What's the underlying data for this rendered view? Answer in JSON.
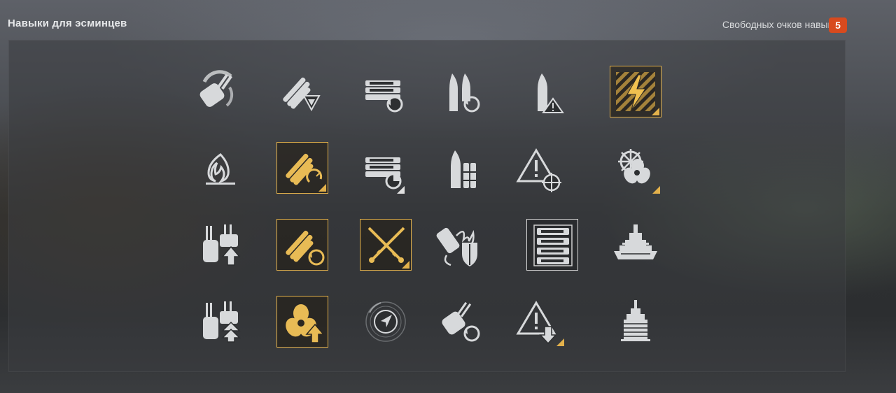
{
  "header": {
    "title": "Навыки для эсминцев",
    "free_points_label": "Свободных очков навыков:",
    "free_points_value": "5"
  },
  "colors": {
    "accent": "#e3b14b",
    "badge": "#d84a1e",
    "icon": "#d7d9db"
  },
  "skills": [
    {
      "name": "turret-rotation-icon",
      "selected": false
    },
    {
      "name": "torpedo-armament-icon",
      "selected": false
    },
    {
      "name": "consumable-reload-icon",
      "selected": false
    },
    {
      "name": "shell-reload-icon",
      "selected": false
    },
    {
      "name": "shell-warning-icon",
      "selected": false
    },
    {
      "name": "lightning-icon",
      "selected": true
    },
    {
      "name": "fire-icon",
      "selected": false
    },
    {
      "name": "torpedo-reload-icon",
      "selected": true
    },
    {
      "name": "consumable-timer-icon",
      "selected": false
    },
    {
      "name": "shell-ammo-icon",
      "selected": false
    },
    {
      "name": "warning-target-icon",
      "selected": false
    },
    {
      "name": "helm-propeller-icon",
      "selected": false
    },
    {
      "name": "turret-upgrade-icon",
      "selected": false
    },
    {
      "name": "torpedo-cycle-icon",
      "selected": true
    },
    {
      "name": "crossed-torpedo-icon",
      "selected": true
    },
    {
      "name": "fire-shield-icon",
      "selected": false
    },
    {
      "name": "consumable-stack-icon",
      "selected": true
    },
    {
      "name": "battleship-icon",
      "selected": false
    },
    {
      "name": "turret-double-upgrade-icon",
      "selected": false
    },
    {
      "name": "propeller-upgrade-icon",
      "selected": true
    },
    {
      "name": "radar-icon",
      "selected": false
    },
    {
      "name": "aa-gun-reload-icon",
      "selected": false
    },
    {
      "name": "warning-down-icon",
      "selected": false
    },
    {
      "name": "battleship-front-icon",
      "selected": false
    }
  ]
}
